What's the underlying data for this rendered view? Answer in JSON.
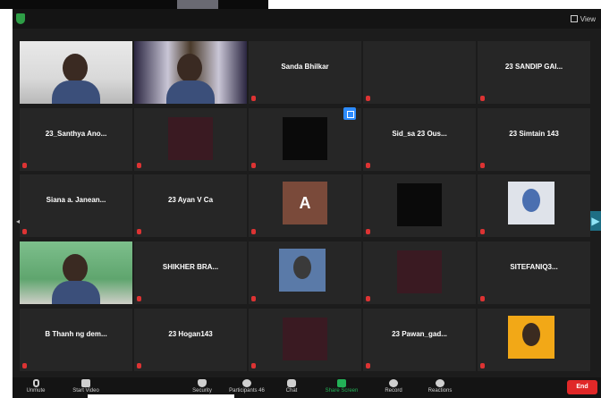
{
  "window": {
    "view_label": "View"
  },
  "participants": [
    {
      "id": "p1",
      "row": 0,
      "col": 0,
      "type": "video",
      "label": ""
    },
    {
      "id": "p2",
      "row": 0,
      "col": 1,
      "type": "video",
      "label": ""
    },
    {
      "id": "p3",
      "row": 0,
      "col": 2,
      "type": "name",
      "name": "Sanda Bhilkar",
      "label": ""
    },
    {
      "id": "p4",
      "row": 0,
      "col": 3,
      "type": "blank",
      "label": ""
    },
    {
      "id": "p5",
      "row": 0,
      "col": 4,
      "type": "name",
      "name": "23 SANDIP GAI...",
      "label": ""
    },
    {
      "id": "p6",
      "row": 1,
      "col": 0,
      "type": "name",
      "name": "23_Santhya Ano...",
      "label": ""
    },
    {
      "id": "p7",
      "row": 1,
      "col": 1,
      "type": "dark",
      "label": ""
    },
    {
      "id": "p8",
      "row": 1,
      "col": 2,
      "type": "dark",
      "label": ""
    },
    {
      "id": "p9",
      "row": 1,
      "col": 3,
      "type": "name",
      "name": "Sid_sa 23 Ous...",
      "label": ""
    },
    {
      "id": "p10",
      "row": 1,
      "col": 4,
      "type": "name",
      "name": "23 Simtain 143",
      "label": ""
    },
    {
      "id": "p11",
      "row": 2,
      "col": 0,
      "type": "name",
      "name": "Siana a. Janean...",
      "label": ""
    },
    {
      "id": "p12",
      "row": 2,
      "col": 1,
      "type": "name",
      "name": "23 Ayan V Ca",
      "label": ""
    },
    {
      "id": "p13",
      "row": 2,
      "col": 2,
      "type": "avatar",
      "initial": "A",
      "label": ""
    },
    {
      "id": "p14",
      "row": 2,
      "col": 3,
      "type": "dark",
      "label": ""
    },
    {
      "id": "p15",
      "row": 2,
      "col": 4,
      "type": "photo",
      "label": ""
    },
    {
      "id": "p16",
      "row": 3,
      "col": 0,
      "type": "video",
      "label": ""
    },
    {
      "id": "p17",
      "row": 3,
      "col": 1,
      "type": "name",
      "name": "SHIKHER BRA...",
      "label": ""
    },
    {
      "id": "p18",
      "row": 3,
      "col": 2,
      "type": "photo",
      "label": ""
    },
    {
      "id": "p19",
      "row": 3,
      "col": 3,
      "type": "dark",
      "label": ""
    },
    {
      "id": "p20",
      "row": 3,
      "col": 4,
      "type": "name",
      "name": "SITEFANIQ3...",
      "label": ""
    },
    {
      "id": "p21",
      "row": 4,
      "col": 0,
      "type": "name",
      "name": "B Thanh ng dem...",
      "label": ""
    },
    {
      "id": "p22",
      "row": 4,
      "col": 1,
      "type": "name",
      "name": "23 Hogan143",
      "label": ""
    },
    {
      "id": "p23",
      "row": 4,
      "col": 2,
      "type": "dark",
      "label": ""
    },
    {
      "id": "p24",
      "row": 4,
      "col": 3,
      "type": "name",
      "name": "23 Pawan_gad...",
      "label": ""
    },
    {
      "id": "p25",
      "row": 4,
      "col": 4,
      "type": "photo",
      "label": ""
    }
  ],
  "toolbar": {
    "unmute": "Unmute",
    "video": "Start Video",
    "security": "Security",
    "participants": "Participants",
    "participants_count": "46",
    "chat": "Chat",
    "share": "Share Screen",
    "record": "Record",
    "reactions": "Reactions",
    "end": "End"
  },
  "colors": {
    "accent": "#2d8cff",
    "share": "#23b157",
    "end": "#e02828",
    "tile_bg": "#262626",
    "window_bg": "#1c1c1c"
  }
}
